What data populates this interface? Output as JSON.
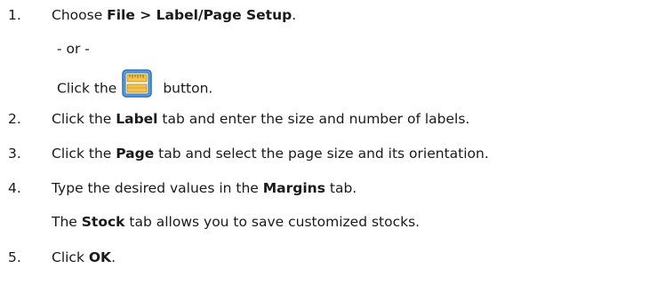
{
  "steps": [
    {
      "number": "1.",
      "parts": [
        "Choose ",
        "File > Label/Page Setup",
        "."
      ],
      "alternative": {
        "or_text": "- or -",
        "click_prefix": "Click the",
        "click_suffix": "button.",
        "button_icon": "label-page-setup-icon"
      }
    },
    {
      "number": "2.",
      "parts": [
        "Click the ",
        "Label",
        " tab and enter the size and number of labels."
      ]
    },
    {
      "number": "3.",
      "parts": [
        "Click the ",
        "Page",
        " tab and select the page size and its orientation."
      ]
    },
    {
      "number": "4.",
      "parts": [
        "Type the desired values in the ",
        "Margins",
        " tab."
      ],
      "note": [
        "The ",
        "Stock",
        " tab allows you to save customized stocks."
      ]
    },
    {
      "number": "5.",
      "parts": [
        "Click ",
        "OK",
        "."
      ]
    }
  ],
  "colors": {
    "text": "#1a1a1a",
    "icon_frame": "#4a90d9",
    "icon_fill": "#f3c34a"
  }
}
